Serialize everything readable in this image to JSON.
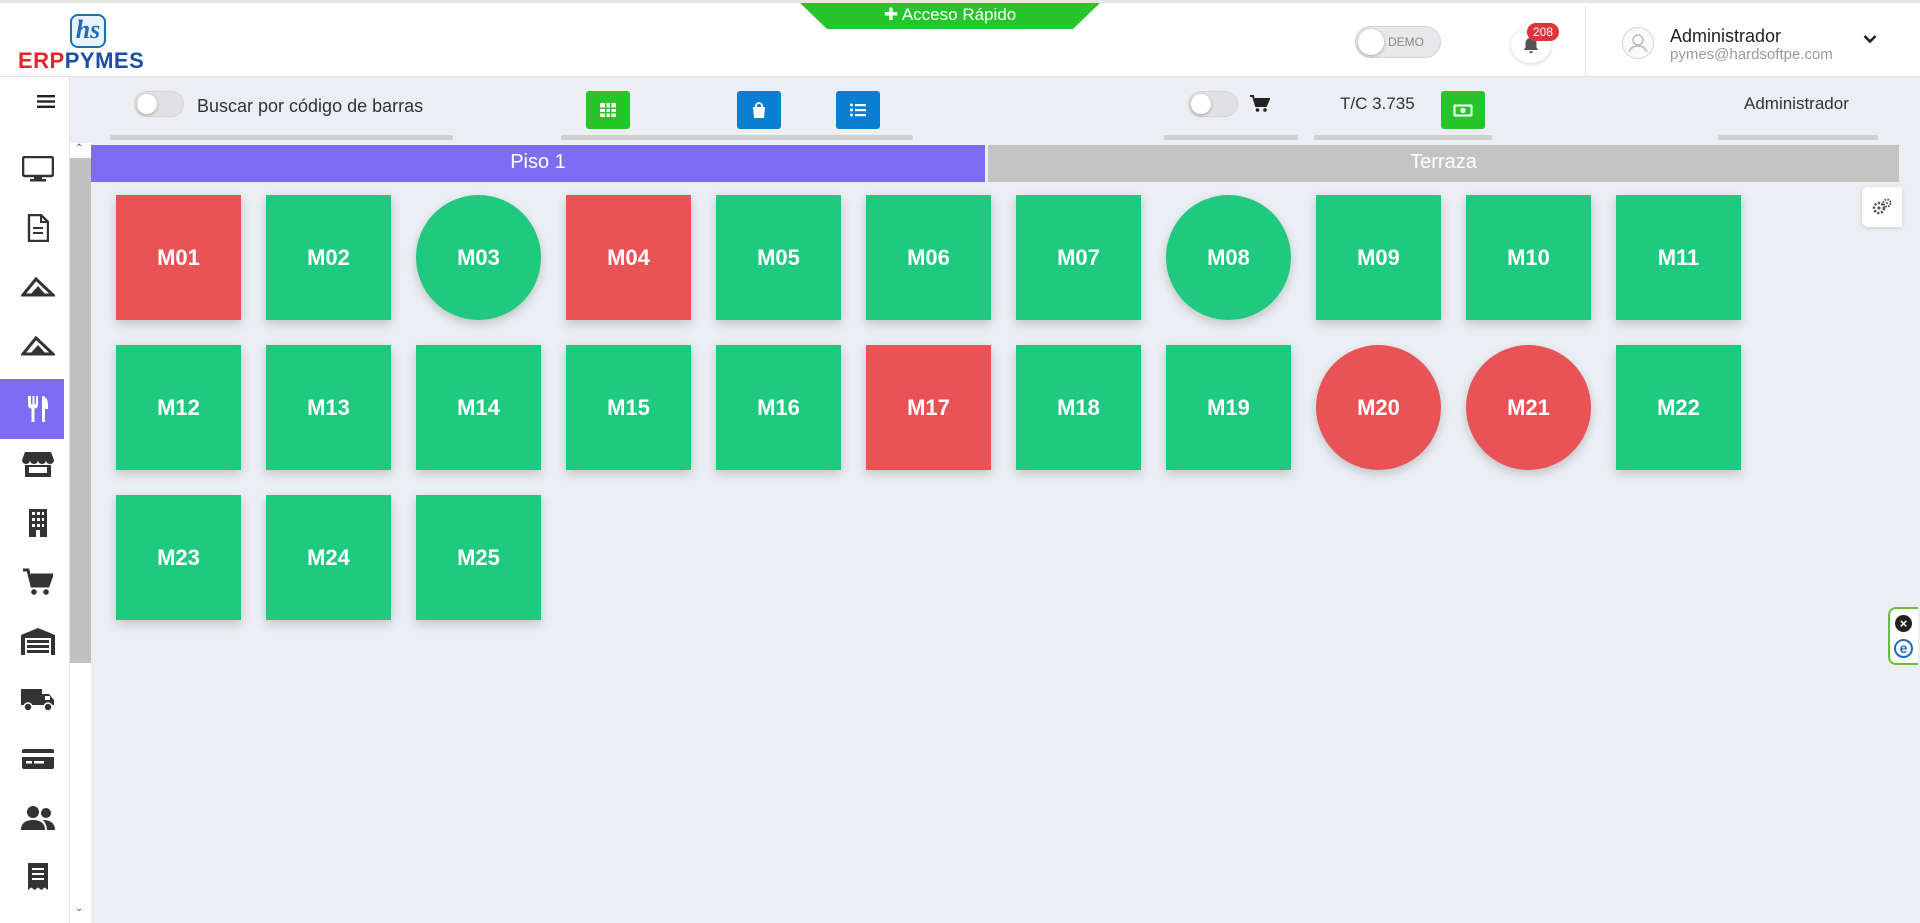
{
  "header": {
    "logo_top": "hs",
    "logo_erp": "ERP",
    "logo_pymes": "PYMES",
    "quick_access": "✚ Acceso Rápido",
    "demo_label": "DEMO",
    "notifications_count": "208",
    "user_name": "Administrador",
    "user_email": "pymes@hardsoftpe.com"
  },
  "sidebar": {
    "icons": [
      "desktop-icon",
      "document-icon",
      "sales-icon",
      "purchases-icon",
      "restaurant-icon",
      "store-icon",
      "building-icon",
      "cart-icon",
      "warehouse-icon",
      "truck-icon",
      "card-icon",
      "users-icon",
      "receipt-icon"
    ],
    "active": "restaurant-icon"
  },
  "toolbar": {
    "barcode_label": "Buscar por código de barras",
    "exchange_rate": "T/C 3.735",
    "user_label": "Administrador",
    "colors": {
      "grid_button": "#27c52c",
      "bag_button": "#0a7ed0",
      "list_button": "#0a7ed0",
      "cash_button": "#27c52c"
    }
  },
  "tabs": [
    {
      "label": "Piso 1",
      "active": true
    },
    {
      "label": "Terraza",
      "active": false
    }
  ],
  "status_colors": {
    "libre": "#20c980",
    "ocupada": "#ea5356"
  },
  "mesas": [
    {
      "label": "M01",
      "status": "ocupada",
      "shape": "square"
    },
    {
      "label": "M02",
      "status": "libre",
      "shape": "square"
    },
    {
      "label": "M03",
      "status": "libre",
      "shape": "round"
    },
    {
      "label": "M04",
      "status": "ocupada",
      "shape": "square"
    },
    {
      "label": "M05",
      "status": "libre",
      "shape": "square"
    },
    {
      "label": "M06",
      "status": "libre",
      "shape": "square"
    },
    {
      "label": "M07",
      "status": "libre",
      "shape": "square"
    },
    {
      "label": "M08",
      "status": "libre",
      "shape": "round"
    },
    {
      "label": "M09",
      "status": "libre",
      "shape": "square"
    },
    {
      "label": "M10",
      "status": "libre",
      "shape": "square"
    },
    {
      "label": "M11",
      "status": "libre",
      "shape": "square"
    },
    {
      "label": "M12",
      "status": "libre",
      "shape": "square"
    },
    {
      "label": "M13",
      "status": "libre",
      "shape": "square"
    },
    {
      "label": "M14",
      "status": "libre",
      "shape": "square"
    },
    {
      "label": "M15",
      "status": "libre",
      "shape": "square"
    },
    {
      "label": "M16",
      "status": "libre",
      "shape": "square"
    },
    {
      "label": "M17",
      "status": "ocupada",
      "shape": "square"
    },
    {
      "label": "M18",
      "status": "libre",
      "shape": "square"
    },
    {
      "label": "M19",
      "status": "libre",
      "shape": "square"
    },
    {
      "label": "M20",
      "status": "ocupada",
      "shape": "round"
    },
    {
      "label": "M21",
      "status": "ocupada",
      "shape": "round"
    },
    {
      "label": "M22",
      "status": "libre",
      "shape": "square"
    },
    {
      "label": "M23",
      "status": "libre",
      "shape": "square"
    },
    {
      "label": "M24",
      "status": "libre",
      "shape": "square"
    },
    {
      "label": "M25",
      "status": "libre",
      "shape": "square"
    }
  ]
}
